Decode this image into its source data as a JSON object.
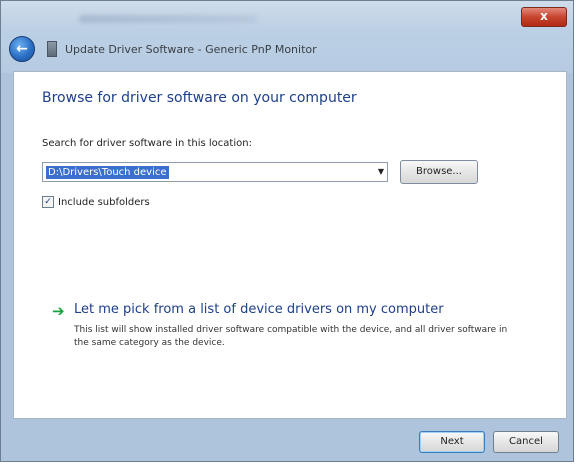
{
  "window": {
    "title": "Update Driver Software - Generic PnP Monitor",
    "close_label": "x"
  },
  "page": {
    "heading": "Browse for driver software on your computer",
    "search_label": "Search for driver software in this location:",
    "path_value": "D:\\Drivers\\Touch device",
    "browse_label": "Browse...",
    "include_subfolders_label": "Include subfolders",
    "include_subfolders_checked": true,
    "pick_title": "Let me pick from a list of device drivers on my computer",
    "pick_description": "This list will show installed driver software compatible with the device, and all driver software in the same category as the device."
  },
  "footer": {
    "next_label": "Next",
    "cancel_label": "Cancel"
  },
  "icons": {
    "back": "back-arrow-icon",
    "device": "monitor-icon",
    "dropdown": "chevron-down-icon",
    "checkbox": "checkmark-icon",
    "pick": "green-arrow-icon"
  },
  "colors": {
    "heading": "#1e3f8a",
    "selection": "#3a6fcf",
    "pick_arrow": "#19a23b",
    "close_button": "#c7452f"
  }
}
